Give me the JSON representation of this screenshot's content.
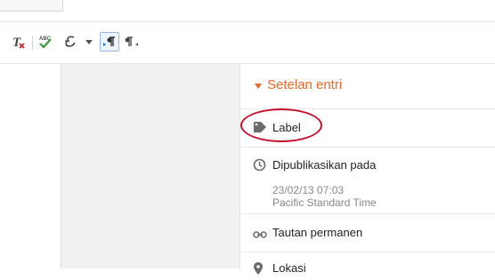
{
  "toolbar": {
    "icons": [
      "clear-formatting-icon",
      "spellcheck-icon",
      "input-tools-icon",
      "dropdown-arrow-icon",
      "ltr-direction-icon",
      "rtl-direction-icon"
    ]
  },
  "panel": {
    "title": "Setelan entri",
    "items": {
      "label": {
        "label": "Label",
        "icon": "tag-icon"
      },
      "published": {
        "label": "Dipublikasikan pada",
        "icon": "clock-icon",
        "date": "23/02/13 07:03",
        "timezone": "Pacific Standard Time"
      },
      "permalink": {
        "label": "Tautan permanen",
        "icon": "link-icon"
      },
      "location": {
        "label": "Lokasi",
        "icon": "location-pin-icon"
      }
    }
  },
  "colors": {
    "accent": "#e8692a",
    "highlight_ellipse": "#c8102e"
  }
}
